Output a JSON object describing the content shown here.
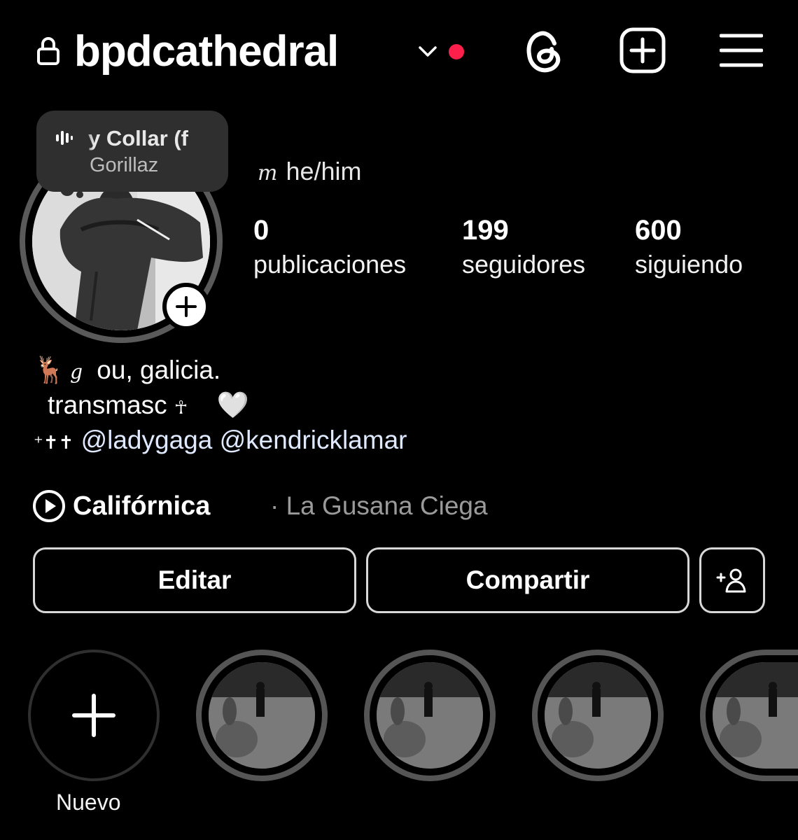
{
  "header": {
    "username": "bpdcathedral",
    "icons": [
      "lock-icon",
      "chevron-down-icon",
      "notification-dot",
      "threads-icon",
      "new-post-icon",
      "menu-icon"
    ],
    "notification_color": "#ff1f4b"
  },
  "note": {
    "song": "y Collar (f",
    "artist": "Gorillaz"
  },
  "profile": {
    "pronouns_symbol": "m",
    "pronouns": "he/him",
    "stats": [
      {
        "value": "0",
        "label": "publicaciones"
      },
      {
        "value": "199",
        "label": "seguidores"
      },
      {
        "value": "600",
        "label": "siguiendo"
      }
    ]
  },
  "bio": {
    "line1_emoji": "🦌",
    "line1_symbol": "g",
    "line1_text": "ou, galicia.",
    "line2_text": "transmasc",
    "line2_cross": "☥",
    "line2_heart": "🤍",
    "line3_crosses": "⁺✝✝",
    "mention1": "@ladygaga",
    "mention2": "@kendricklamar"
  },
  "music": {
    "song": "Califórnica",
    "separator": "·",
    "artist": "La Gusana Ciega"
  },
  "buttons": {
    "edit": "Editar",
    "share": "Compartir"
  },
  "highlights": {
    "new_label": "Nuevo",
    "count_visible": 4
  }
}
